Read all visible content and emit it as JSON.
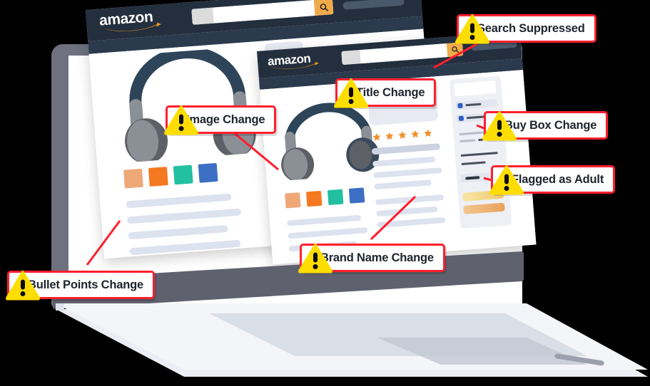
{
  "scene": {
    "device": "laptop",
    "description": "Amazon product listing pages on a laptop with warning callouts"
  },
  "colors": {
    "warning_yellow": "#ffdd00",
    "callout_red": "#ff1f2e",
    "amazon_navy": "#232f3e",
    "amazon_orange": "#f0ab4c",
    "star_orange": "#f0912e",
    "laptop_bezel": "#6f7180",
    "placeholder_gray": "#dde2ef"
  },
  "browser_windows": [
    {
      "id": "rear-window",
      "brand": "amazon",
      "search": {
        "value": "",
        "placeholder": ""
      },
      "search_icon": "magnifier-icon",
      "swatches": [
        "#efa878",
        "#f47920",
        "#22bfa0",
        "#3d6fc4"
      ],
      "product_image": "headphones-illustration"
    },
    {
      "id": "front-window",
      "brand": "amazon",
      "search": {
        "value": "",
        "placeholder": ""
      },
      "search_icon": "magnifier-icon",
      "swatches": [
        "#efa878",
        "#f47920",
        "#22bfa0",
        "#3d6fc4"
      ],
      "product_image": "headphones-illustration",
      "rating_stars": 5,
      "buy_box": {
        "option_count": 2,
        "buttons": [
          "add-to-cart",
          "buy-now"
        ]
      }
    }
  ],
  "callouts": [
    {
      "id": "search-suppressed",
      "label": "Search Suppressed",
      "icon": "warning-triangle-icon"
    },
    {
      "id": "title-change",
      "label": "Title Change",
      "icon": "warning-triangle-icon"
    },
    {
      "id": "buy-box-change",
      "label": "Buy Box Change",
      "icon": "warning-triangle-icon"
    },
    {
      "id": "flagged-as-adult",
      "label": "Flagged as Adult",
      "icon": "warning-triangle-icon"
    },
    {
      "id": "image-change",
      "label": "Image Change",
      "icon": "warning-triangle-icon"
    },
    {
      "id": "brand-name-change",
      "label": "Brand Name Change",
      "icon": "warning-triangle-icon"
    },
    {
      "id": "bullet-points-change",
      "label": "Bullet Points Change",
      "icon": "warning-triangle-icon"
    }
  ]
}
